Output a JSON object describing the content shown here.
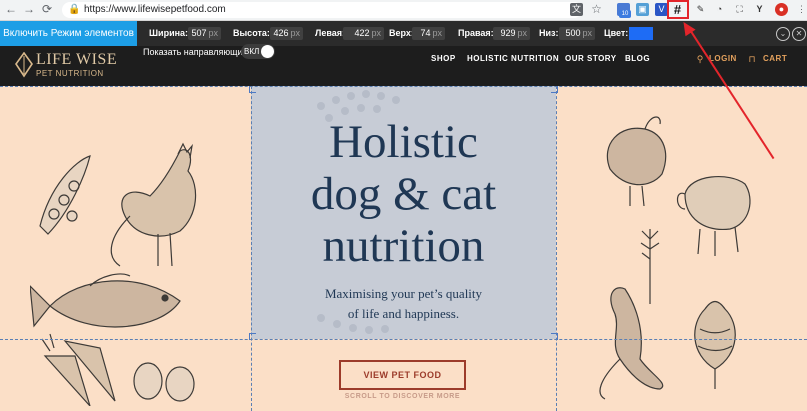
{
  "browser": {
    "url": "https://www.lifewisepetfood.com",
    "back_icon": "arrow-left",
    "forward_icon": "arrow-right",
    "reload_icon": "reload",
    "extensions": [
      "translate-icon",
      "star-icon",
      "extension-badge-icon",
      "extension-icon",
      "v-extension-icon",
      "grid-ruler-icon",
      "eyedropper-icon",
      "speed-icon",
      "screenshot-icon",
      "y-extension-icon",
      "profile-icon",
      "menu-icon"
    ],
    "extension_badge": "10"
  },
  "ruler_toolbar": {
    "toggle_label": "Включить Режим элементов",
    "width_label": "Ширина:",
    "width_value": "507",
    "height_label": "Высота:",
    "height_value": "426",
    "left_label": "Левая:",
    "left_value": "422",
    "top_label": "Верх:",
    "top_value": "74",
    "right_label": "Правая:",
    "right_value": "929",
    "bottom_label": "Низ:",
    "bottom_value": "500",
    "unit": "px",
    "color_label": "Цвет:",
    "color_value": "#1e6cf5",
    "show_guides_label": "Показать направляющие:",
    "switch_label": "ВКЛ"
  },
  "site": {
    "logo_main": "LIFE WISE",
    "logo_sub": "PET NUTRITION",
    "nav": [
      "SHOP",
      "HOLISTIC NUTRITION",
      "OUR STORY",
      "BLOG"
    ],
    "login": "LOGIN",
    "cart": "CART",
    "hero_title_lines": [
      "Holistic",
      "dog & cat",
      "nutrition"
    ],
    "hero_sub_lines": [
      "Maximising your pet’s quality",
      "of life and happiness."
    ],
    "cta": "VIEW PET FOOD",
    "scroll_hint": "SCROLL TO DISCOVER MORE"
  },
  "colors": {
    "accent": "#1d9ee6",
    "hero_bg": "#fbdfc7",
    "panel_bg": "#c7ccd6",
    "title": "#1f3754",
    "cta": "#9c3b2a",
    "annotation": "#e3252b"
  }
}
